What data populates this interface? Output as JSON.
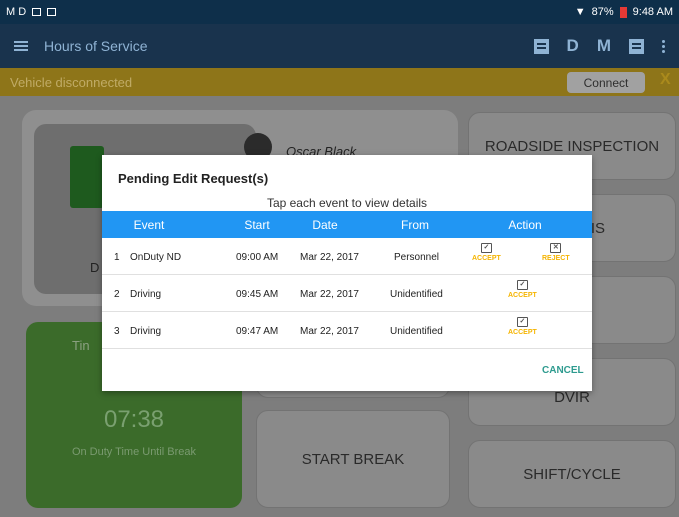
{
  "status_bar": {
    "left": "M D",
    "signal": "87%",
    "time": "9:48 AM"
  },
  "app_bar": {
    "title": "Hours of Service",
    "letter_d": "D",
    "letter_m": "M"
  },
  "alert": {
    "text": "Vehicle disconnected",
    "connect_label": "Connect",
    "close_label": "X"
  },
  "dashboard": {
    "driver_name": "Oscar Black",
    "status_letter": "D",
    "timer_label_partial": "Tin",
    "timer_value": "07:38",
    "timer_caption": "On Duty Time Until Break",
    "tiles": {
      "roadside": "ROADSIDE INSPECTION",
      "partial_is": "IS",
      "dvir": "DVIR",
      "start_break": "START BREAK",
      "shift_cycle": "SHIFT/CYCLE"
    }
  },
  "modal": {
    "title": "Pending Edit Request(s)",
    "subtitle": "Tap each event to view details",
    "columns": [
      "Event",
      "Start",
      "Date",
      "From",
      "Action"
    ],
    "rows": [
      {
        "num": "1",
        "event": "OnDuty ND",
        "start": "09:00 AM",
        "date": "Mar 22, 2017",
        "from": "Personnel",
        "accept": "ACCEPT",
        "reject": "REJECT"
      },
      {
        "num": "2",
        "event": "Driving",
        "start": "09:45 AM",
        "date": "Mar 22, 2017",
        "from": "Unidentified",
        "accept": "ACCEPT"
      },
      {
        "num": "3",
        "event": "Driving",
        "start": "09:47 AM",
        "date": "Mar 22, 2017",
        "from": "Unidentified",
        "accept": "ACCEPT"
      }
    ],
    "cancel_label": "CANCEL"
  }
}
